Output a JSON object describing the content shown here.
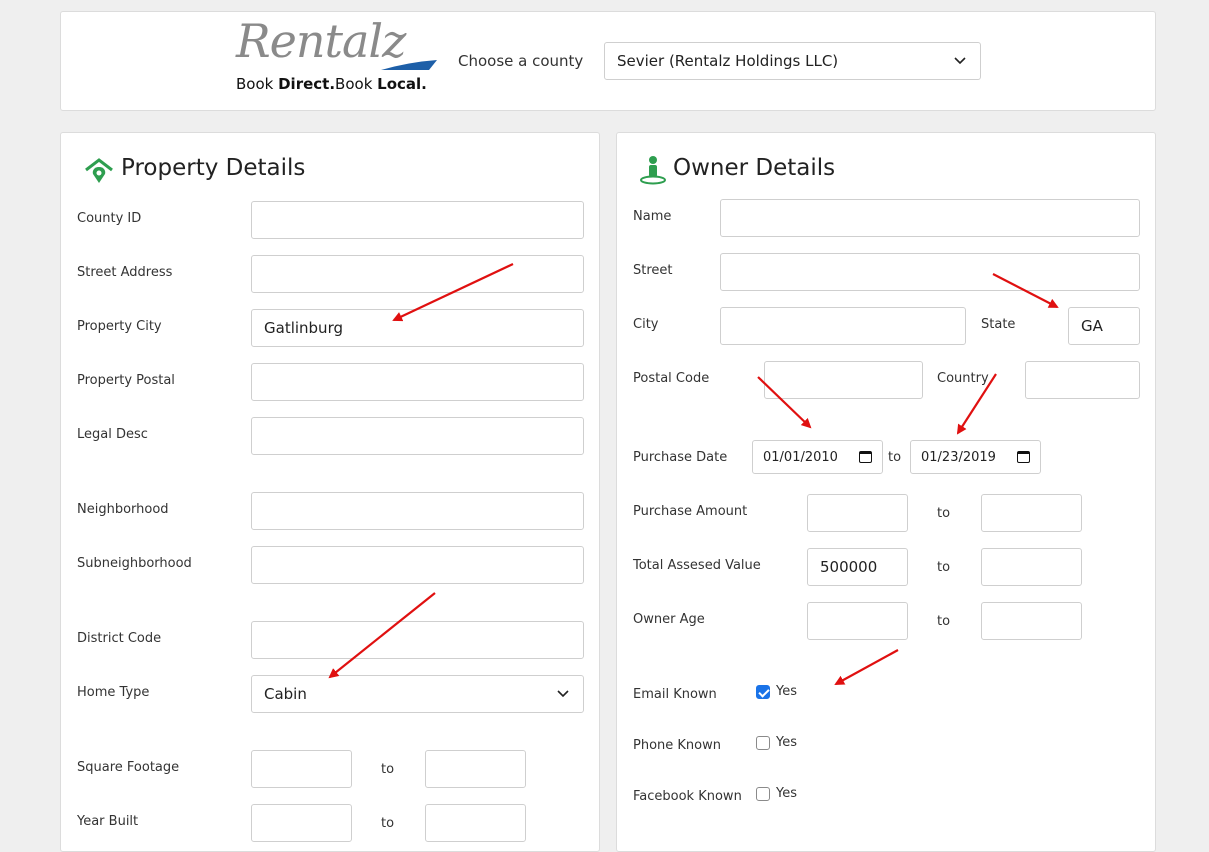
{
  "header": {
    "logo_script": "Rentalz",
    "logo_tag_1": "Book ",
    "logo_tag_2": "Direct.",
    "logo_tag_3": "Book ",
    "logo_tag_4": "Local.",
    "county_label": "Choose a county",
    "county_value": "Sevier  (Rentalz Holdings LLC)"
  },
  "property": {
    "title": "Property Details",
    "county_id": {
      "label": "County ID",
      "value": ""
    },
    "street_address": {
      "label": "Street Address",
      "value": ""
    },
    "property_city": {
      "label": "Property City",
      "value": "Gatlinburg"
    },
    "property_postal": {
      "label": "Property Postal",
      "value": ""
    },
    "legal_desc": {
      "label": "Legal Desc",
      "value": ""
    },
    "neighborhood": {
      "label": "Neighborhood",
      "value": ""
    },
    "subneighborhood": {
      "label": "Subneighborhood",
      "value": ""
    },
    "district_code": {
      "label": "District Code",
      "value": ""
    },
    "home_type": {
      "label": "Home Type",
      "value": "Cabin"
    },
    "square_footage": {
      "label": "Square Footage",
      "from": "",
      "to_label": "to",
      "to": ""
    },
    "year_built": {
      "label": "Year Built",
      "from": "",
      "to_label": "to",
      "to": ""
    }
  },
  "owner": {
    "title": "Owner Details",
    "name": {
      "label": "Name",
      "value": ""
    },
    "street": {
      "label": "Street",
      "value": ""
    },
    "city": {
      "label": "City",
      "value": ""
    },
    "state": {
      "label": "State",
      "value": "GA"
    },
    "postal_code": {
      "label": "Postal Code",
      "value": ""
    },
    "country": {
      "label": "Country",
      "value": ""
    },
    "purchase_date": {
      "label": "Purchase Date",
      "from": "01/01/2010",
      "to_label": "to",
      "to": "01/23/2019"
    },
    "purchase_amount": {
      "label": "Purchase Amount",
      "from": "",
      "to_label": "to",
      "to": ""
    },
    "total_assessed": {
      "label": "Total Assesed Value",
      "from": "500000",
      "to_label": "to",
      "to": ""
    },
    "owner_age": {
      "label": "Owner Age",
      "from": "",
      "to_label": "to",
      "to": ""
    },
    "email_known": {
      "label": "Email Known",
      "option": "Yes",
      "checked": true
    },
    "phone_known": {
      "label": "Phone Known",
      "option": "Yes",
      "checked": false
    },
    "facebook_known": {
      "label": "Facebook Known",
      "option": "Yes",
      "checked": false
    }
  },
  "colors": {
    "accent": "#1a73e8",
    "icon_green": "#2e9e4f",
    "annotation_red": "#e01010"
  }
}
